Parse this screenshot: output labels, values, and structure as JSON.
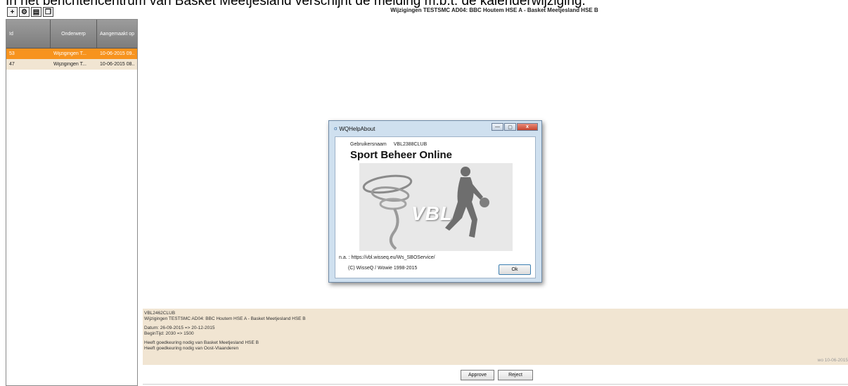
{
  "caption": "In het berichtencentrum van Basket Meetjesland verschijnt de melding m.b.t. de kalenderwijziging.",
  "window_title": "Wijzigingen TESTSMC AD04: BBC Houtem HSE A - Basket Meetjesland HSE B",
  "toolbar": {
    "icons": [
      "plus-icon",
      "settings-icon",
      "list-icon",
      "copy-icon"
    ],
    "glyphs": [
      "+",
      "⚙",
      "▤",
      "❐"
    ]
  },
  "grid": {
    "headers": [
      "Id",
      "Onderwerp",
      "Aangemaakt op"
    ],
    "rows": [
      {
        "id": "53",
        "subject": "Wijzigingen T...",
        "created": "10-06-2015 09..",
        "selected": true
      },
      {
        "id": "47",
        "subject": "Wijzigingen T...",
        "created": "10-06-2015 08..",
        "selected": false
      }
    ]
  },
  "about_dialog": {
    "title": "WQHelpAbout",
    "title_icon": "app-icon",
    "user_label": "Gebruikersnaam",
    "user_value": "VBL2388CLUB",
    "app_name": "Sport Beheer Online",
    "logo_text": "VBL",
    "url_line": "n.a. : https://vbl.wisseq.eu/Ws_SBOService/",
    "copyright": "(C) WisseQ / Wowie 1998-2015",
    "ok_label": "Ok",
    "controls": {
      "minimize": "—",
      "maximize": "▢",
      "close": "x"
    }
  },
  "message": {
    "sender": "VBL2462CLUB",
    "subject": "Wijzigingen TESTSMC AD04: BBC Houtem HSE A - Basket Meetjesland HSE B",
    "date_line": "Datum: 26-09-2015 => 20-12-2015",
    "time_line": "BeginTijd: 2030 => 1500",
    "approval_1": "Heeft goedkeuring nodig van Basket Meetjesland HSE B",
    "approval_2": "Heeft goedkeuring nodig van Oost-Vlaanderen",
    "timestamp": "wo 10-06-2015"
  },
  "actions": {
    "approve": "Approve",
    "reject": "Reject"
  },
  "colors": {
    "selected_row": "#f7931e",
    "row_bg": "#f1e5d2",
    "header_bg": "#8c8c8c"
  }
}
